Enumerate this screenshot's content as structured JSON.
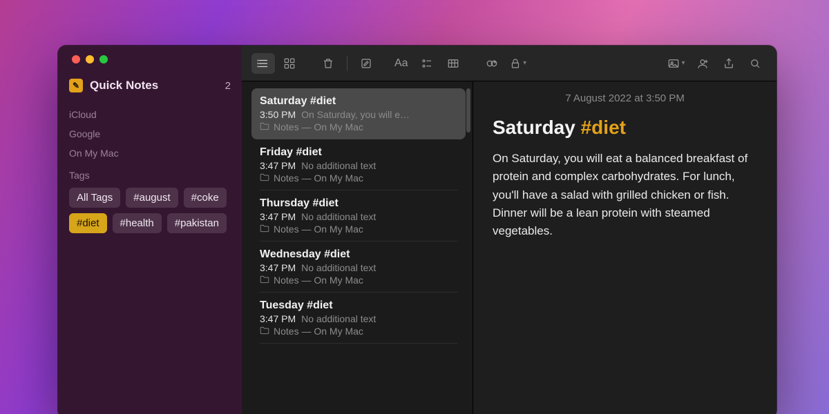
{
  "sidebar": {
    "quick_notes": {
      "label": "Quick Notes",
      "count": "2"
    },
    "locations": [
      "iCloud",
      "Google",
      "On My Mac"
    ],
    "tags_label": "Tags",
    "tags": [
      {
        "label": "All Tags",
        "active": false
      },
      {
        "label": "#august",
        "active": false
      },
      {
        "label": "#coke",
        "active": false
      },
      {
        "label": "#diet",
        "active": true
      },
      {
        "label": "#health",
        "active": false
      },
      {
        "label": "#pakistan",
        "active": false
      }
    ]
  },
  "toolbar": {
    "aa": "Aa"
  },
  "notes": [
    {
      "title": "Saturday #diet",
      "time": "3:50 PM",
      "preview": "On Saturday, you will e…",
      "location": "Notes — On My Mac",
      "selected": true
    },
    {
      "title": "Friday #diet",
      "time": "3:47 PM",
      "preview": "No additional text",
      "location": "Notes — On My Mac",
      "selected": false
    },
    {
      "title": "Thursday #diet",
      "time": "3:47 PM",
      "preview": "No additional text",
      "location": "Notes — On My Mac",
      "selected": false
    },
    {
      "title": "Wednesday #diet",
      "time": "3:47 PM",
      "preview": "No additional text",
      "location": "Notes — On My Mac",
      "selected": false
    },
    {
      "title": "Tuesday #diet",
      "time": "3:47 PM",
      "preview": "No additional text",
      "location": "Notes — On My Mac",
      "selected": false
    }
  ],
  "detail": {
    "date": "7 August 2022 at 3:50 PM",
    "title_plain": "Saturday ",
    "title_hash": "#diet",
    "body": "On Saturday, you will eat a balanced breakfast of protein and complex carbohydrates. For lunch, you'll have a salad with grilled chicken or fish. Dinner will be a lean protein with steamed vegetables."
  }
}
